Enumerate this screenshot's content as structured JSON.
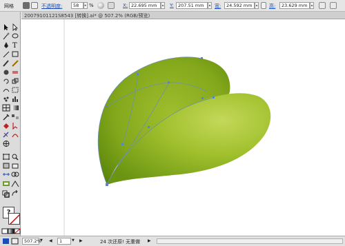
{
  "control_bar": {
    "label_mesh": "网格",
    "opacity_label": "不透明度:",
    "opacity_value": "58",
    "percent": "%",
    "x_label": "X:",
    "x_value": "22.695 mm",
    "y_label": "Y:",
    "y_value": "207.51 mm",
    "w_label": "宽:",
    "w_value": "24.592 mm",
    "h_label": "高:",
    "h_value": "23.629 mm"
  },
  "document": {
    "tab_title": "20079101121S8543 [转换].ai* @ 507.2% (RGB/预览)"
  },
  "status_bar": {
    "zoom": "507.2%",
    "page": "1",
    "status_text": "24 次还原! 无重做"
  },
  "colors": {
    "leaf_dark": "#5f8a0e",
    "leaf_light": "#b3cd3e",
    "mesh_line": "#6d8fb0",
    "link": "#1b4fb8"
  }
}
